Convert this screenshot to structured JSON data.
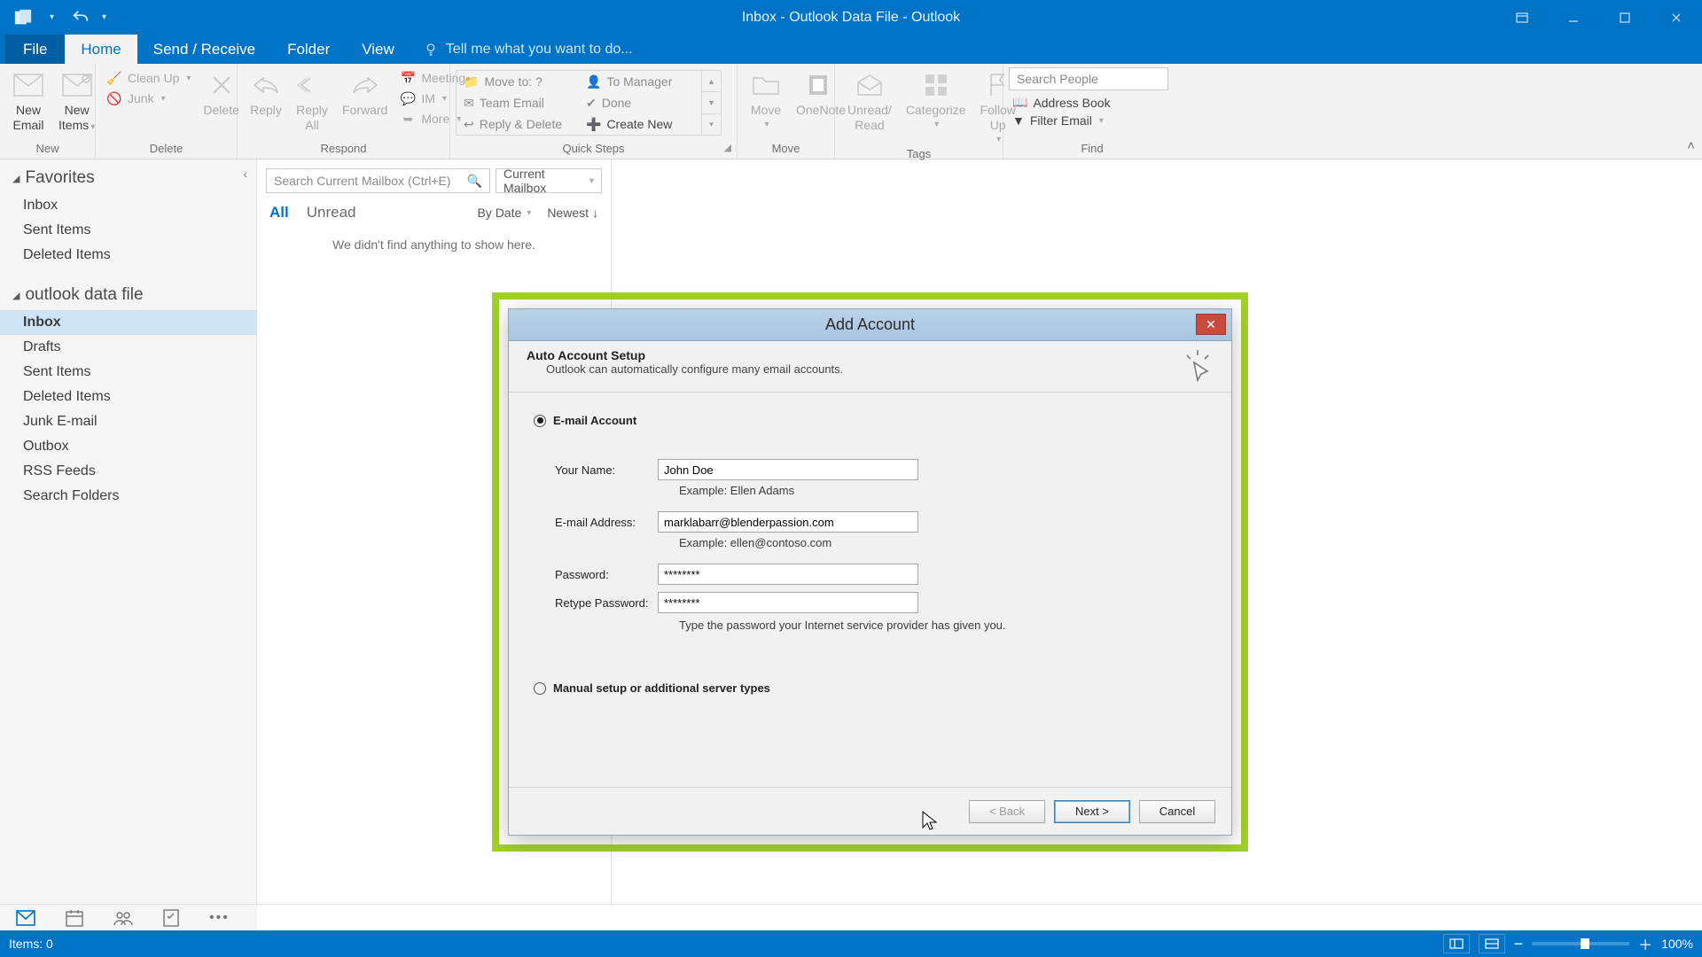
{
  "titlebar": {
    "title": "Inbox - Outlook Data File - Outlook"
  },
  "tabs": {
    "file": "File",
    "items": [
      "Home",
      "Send / Receive",
      "Folder",
      "View"
    ],
    "active": "Home",
    "tellme": "Tell me what you want to do..."
  },
  "ribbon": {
    "new": {
      "label": "New",
      "email": "New\nEmail",
      "items": "New\nItems"
    },
    "delete": {
      "label": "Delete",
      "cleanup": "Clean Up",
      "junk": "Junk",
      "delete": "Delete"
    },
    "respond": {
      "label": "Respond",
      "reply": "Reply",
      "replyall": "Reply\nAll",
      "forward": "Forward",
      "meeting": "Meeting",
      "im": "IM",
      "more": "More"
    },
    "quicksteps": {
      "label": "Quick Steps",
      "moveto": "Move to: ?",
      "teamemail": "Team Email",
      "replydelete": "Reply & Delete",
      "tomanager": "To Manager",
      "done": "Done",
      "createnew": "Create New"
    },
    "move": {
      "label": "Move",
      "move": "Move",
      "onenote": "OneNote"
    },
    "tags": {
      "label": "Tags",
      "unread": "Unread/\nRead",
      "categorize": "Categorize",
      "followup": "Follow\nUp"
    },
    "find": {
      "label": "Find",
      "search_placeholder": "Search People",
      "addressbook": "Address Book",
      "filteremail": "Filter Email"
    }
  },
  "nav": {
    "favorites": {
      "header": "Favorites",
      "items": [
        "Inbox",
        "Sent Items",
        "Deleted Items"
      ]
    },
    "datafile": {
      "header": "outlook data file",
      "items": [
        "Inbox",
        "Drafts",
        "Sent Items",
        "Deleted Items",
        "Junk E-mail",
        "Outbox",
        "RSS Feeds",
        "Search Folders"
      ],
      "active": "Inbox"
    }
  },
  "list": {
    "search_placeholder": "Search Current Mailbox (Ctrl+E)",
    "scope": "Current Mailbox",
    "filters": {
      "all": "All",
      "unread": "Unread"
    },
    "sort_by": "By Date",
    "sort_order": "Newest",
    "empty": "We didn't find anything to show here."
  },
  "status": {
    "items": "Items: 0",
    "zoom": "100%"
  },
  "dialog": {
    "title": "Add Account",
    "header_title": "Auto Account Setup",
    "header_sub": "Outlook can automatically configure many email accounts.",
    "radio_email": "E-mail Account",
    "radio_manual": "Manual setup or additional server types",
    "labels": {
      "name": "Your Name:",
      "email": "E-mail Address:",
      "pw": "Password:",
      "pw2": "Retype Password:"
    },
    "values": {
      "name": "John Doe",
      "email": "marklabarr@blenderpassion.com",
      "pw": "********",
      "pw2": "********"
    },
    "hints": {
      "name": "Example: Ellen Adams",
      "email": "Example: ellen@contoso.com",
      "pw": "Type the password your Internet service provider has given you."
    },
    "buttons": {
      "back": "< Back",
      "next": "Next >",
      "cancel": "Cancel"
    }
  }
}
